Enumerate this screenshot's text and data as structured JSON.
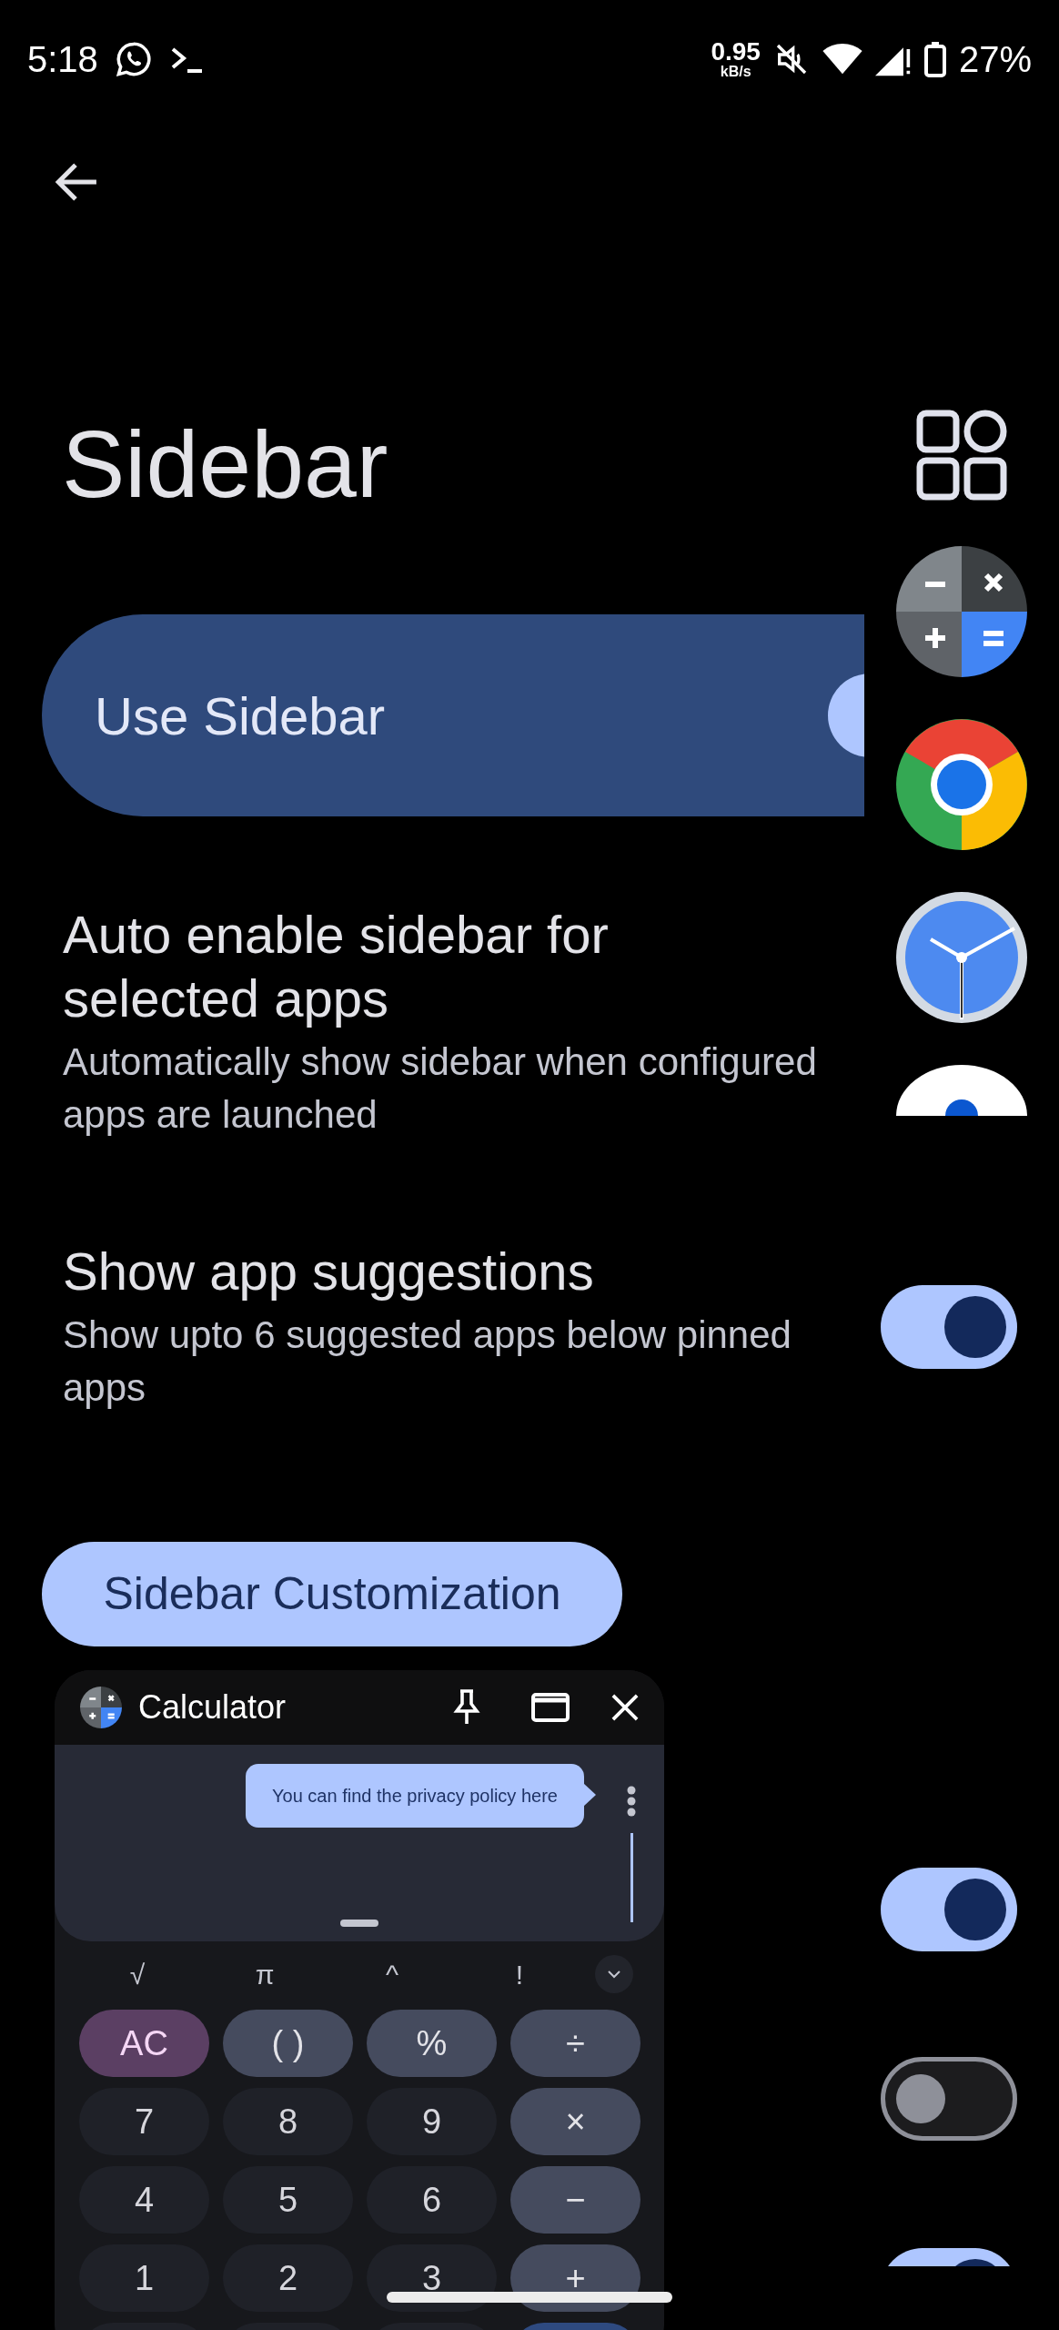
{
  "status_bar": {
    "time": "5:18",
    "net_speed": "0.95",
    "net_unit": "kB/s",
    "battery": "27%"
  },
  "page": {
    "title": "Sidebar"
  },
  "main_switch": {
    "label": "Use Sidebar",
    "on": true
  },
  "settings": [
    {
      "title": "Auto enable sidebar for selected apps",
      "subtitle": "Automatically show sidebar when configured apps are launched"
    },
    {
      "title": "Show app suggestions",
      "subtitle": "Show upto 6 suggested apps below pinned apps",
      "on": true
    }
  ],
  "customization_button": "Sidebar Customization",
  "lower_toggles": [
    {
      "on": true
    },
    {
      "on": false
    },
    {
      "on": true
    }
  ],
  "sidebar": {
    "apps": [
      {
        "kind": "calculator"
      },
      {
        "kind": "browser"
      },
      {
        "kind": "clock"
      },
      {
        "kind": "eye"
      }
    ]
  },
  "floating_window": {
    "title": "Calculator",
    "tooltip": "You can find the privacy policy here",
    "function_keys": [
      "√",
      "π",
      "^",
      "!"
    ],
    "keys": [
      {
        "label": "AC",
        "kind": "clear"
      },
      {
        "label": "( )",
        "kind": "op"
      },
      {
        "label": "%",
        "kind": "op"
      },
      {
        "label": "÷",
        "kind": "op"
      },
      {
        "label": "7",
        "kind": "digit"
      },
      {
        "label": "8",
        "kind": "digit"
      },
      {
        "label": "9",
        "kind": "digit"
      },
      {
        "label": "×",
        "kind": "op"
      },
      {
        "label": "4",
        "kind": "digit"
      },
      {
        "label": "5",
        "kind": "digit"
      },
      {
        "label": "6",
        "kind": "digit"
      },
      {
        "label": "−",
        "kind": "op"
      },
      {
        "label": "1",
        "kind": "digit"
      },
      {
        "label": "2",
        "kind": "digit"
      },
      {
        "label": "3",
        "kind": "digit"
      },
      {
        "label": "+",
        "kind": "op"
      }
    ]
  }
}
